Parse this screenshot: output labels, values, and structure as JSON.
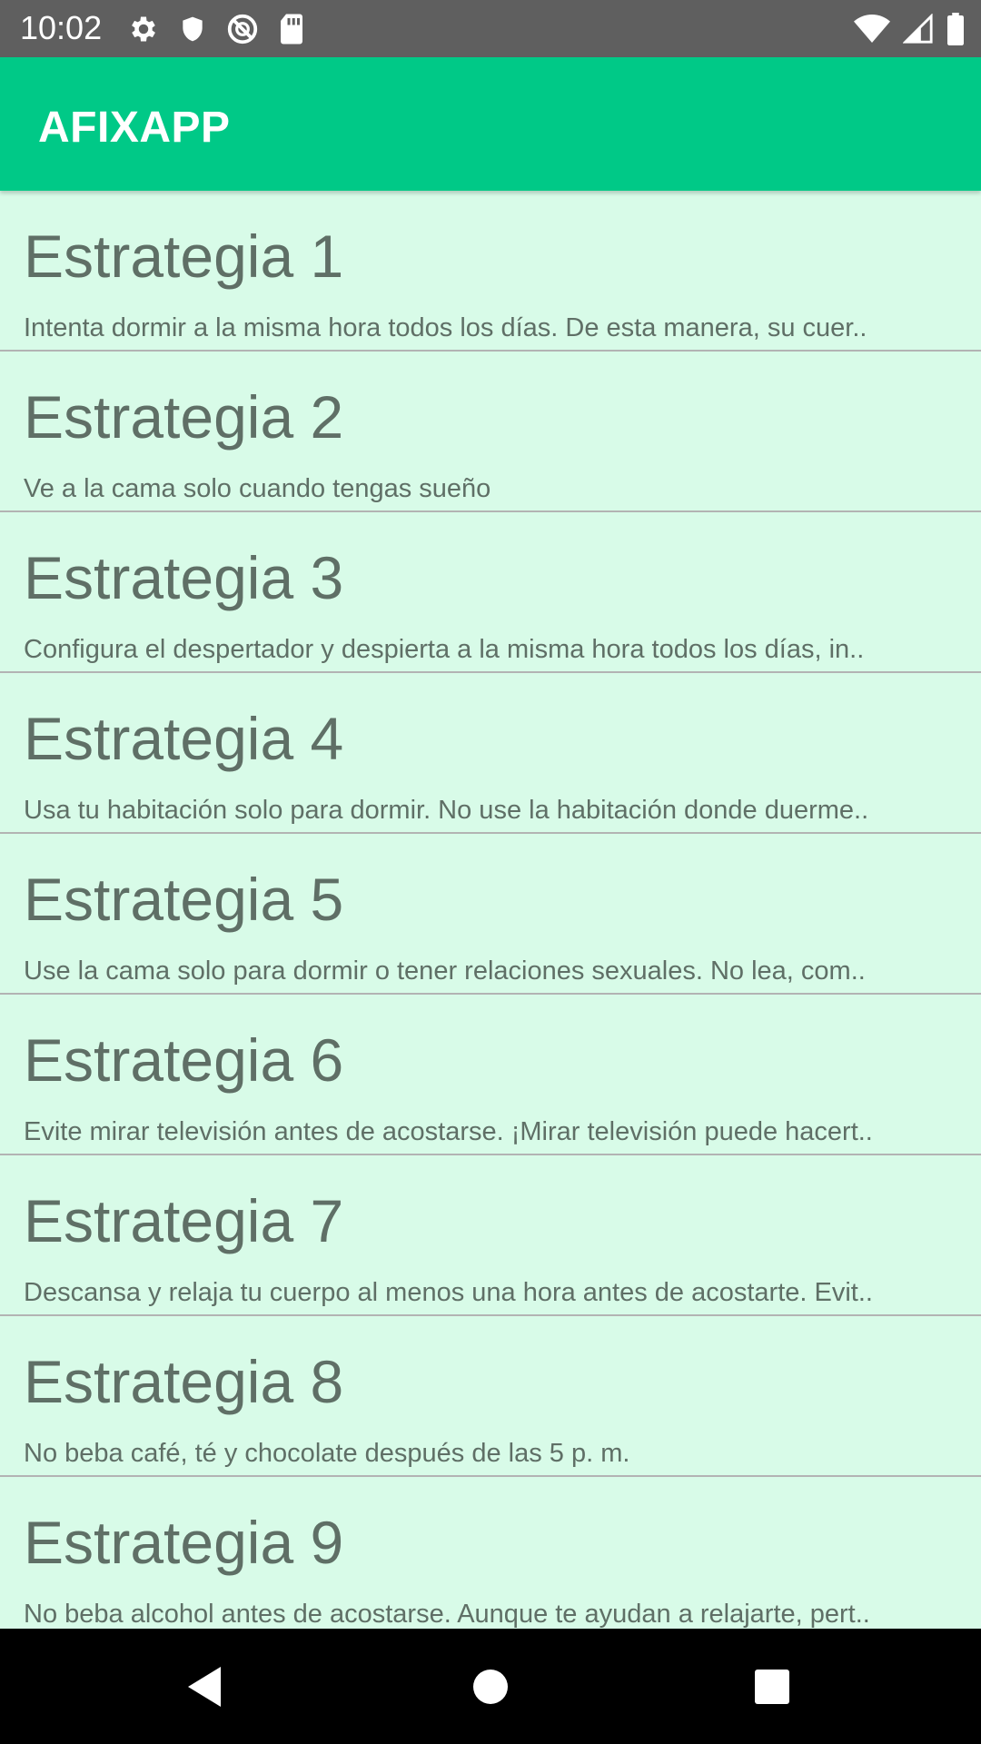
{
  "status_bar": {
    "time": "10:02",
    "left_icons": [
      "gear-icon",
      "shield-icon",
      "no-sync-icon",
      "sd-card-icon"
    ],
    "right_icons": [
      "wifi-icon",
      "cell-signal-icon",
      "battery-icon"
    ]
  },
  "app_bar": {
    "title": "AFIXAPP",
    "color": "#00c987"
  },
  "list": {
    "background": "#d8fbe8",
    "items": [
      {
        "title": "Estrategia 1",
        "desc": "Intenta dormir a la misma hora todos los días. De esta manera, su cuer.."
      },
      {
        "title": "Estrategia 2",
        "desc": "Ve a la cama solo cuando tengas sueño"
      },
      {
        "title": "Estrategia 3",
        "desc": "Configura el despertador y despierta a la misma hora todos los días, in.."
      },
      {
        "title": "Estrategia 4",
        "desc": "Usa tu habitación solo para dormir. No use la habitación donde duerme.."
      },
      {
        "title": "Estrategia 5",
        "desc": "Use la cama solo para dormir o tener relaciones sexuales. No lea, com.."
      },
      {
        "title": "Estrategia 6",
        "desc": "Evite mirar televisión antes de acostarse. ¡Mirar televisión puede hacert.."
      },
      {
        "title": "Estrategia 7",
        "desc": "Descansa y relaja tu cuerpo al menos una hora antes de acostarte. Evit.."
      },
      {
        "title": "Estrategia 8",
        "desc": "No beba café, té y chocolate después de las 5 p. m."
      },
      {
        "title": "Estrategia 9",
        "desc": "No beba alcohol antes de acostarse. Aunque te ayudan a relajarte, pert.."
      }
    ]
  },
  "nav_bar": {
    "buttons": [
      "back-icon",
      "home-icon",
      "recents-icon"
    ]
  }
}
